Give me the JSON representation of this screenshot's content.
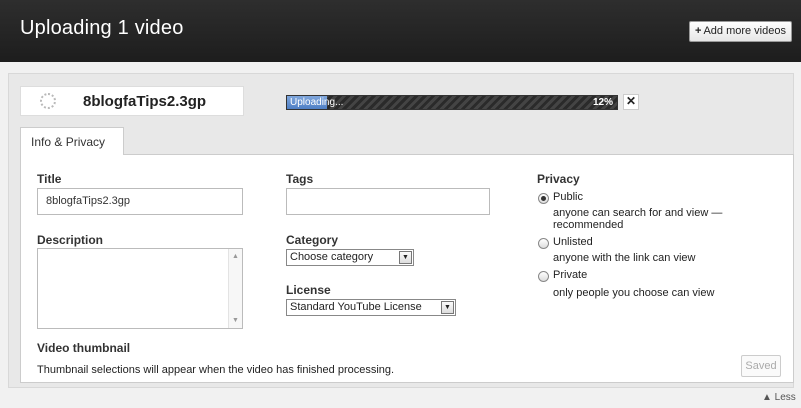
{
  "header": {
    "title": "Uploading 1 video",
    "add_more": "Add more videos",
    "add_more_icon": "plus-icon"
  },
  "upload": {
    "filename": "8blogfaTips2.3gp",
    "status": "Uploading...",
    "percent_label": "12%",
    "progress": 0.12,
    "cancel_icon": "close-icon",
    "cancel_glyph": "✕"
  },
  "tabs": [
    {
      "label": "Info & Privacy"
    }
  ],
  "form": {
    "title_label": "Title",
    "title_value": "8blogfaTips2.3gp",
    "description_label": "Description",
    "description_value": "",
    "tags_label": "Tags",
    "tags_value": "",
    "category_label": "Category",
    "category_value": "Choose category",
    "license_label": "License",
    "license_value": "Standard YouTube License",
    "thumbnail_label": "Video thumbnail",
    "thumbnail_note": "Thumbnail selections will appear when the video has finished processing."
  },
  "privacy": {
    "label": "Privacy",
    "options": [
      {
        "title": "Public",
        "desc": "anyone can search for and view — recommended",
        "checked": true
      },
      {
        "title": "Unlisted",
        "desc": "anyone with the link can view",
        "checked": false
      },
      {
        "title": "Private",
        "desc": "only people you choose can view",
        "checked": false
      }
    ]
  },
  "actions": {
    "saved": "Saved",
    "less": "▲ Less"
  },
  "colors": {
    "header_bg": "#222222",
    "progress_fill": "#5b8bd0",
    "panel_bg": "#e8e8e8"
  }
}
